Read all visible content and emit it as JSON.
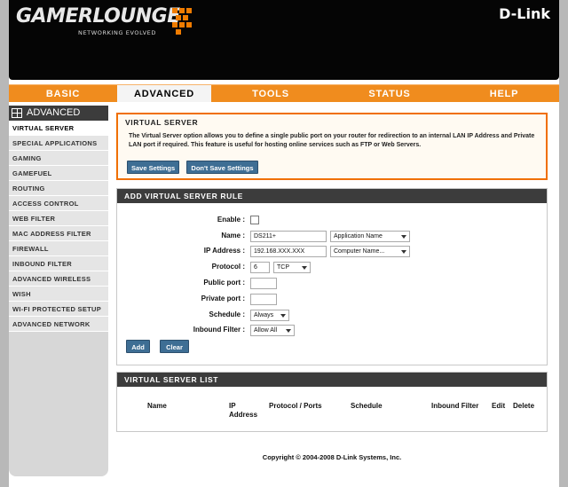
{
  "header": {
    "brand": "GAMERLOUNGE",
    "tagline": "NETWORKING EVOLVED",
    "vendor": "D-Link"
  },
  "topnav": [
    {
      "label": "BASIC",
      "active": false
    },
    {
      "label": "ADVANCED",
      "active": true
    },
    {
      "label": "TOOLS",
      "active": false
    },
    {
      "label": "STATUS",
      "active": false
    },
    {
      "label": "HELP",
      "active": false
    }
  ],
  "sidebar": {
    "title": "ADVANCED",
    "items": [
      {
        "label": "VIRTUAL SERVER",
        "active": true
      },
      {
        "label": "SPECIAL APPLICATIONS"
      },
      {
        "label": "GAMING"
      },
      {
        "label": "GAMEFUEL"
      },
      {
        "label": "ROUTING"
      },
      {
        "label": "ACCESS CONTROL"
      },
      {
        "label": "WEB FILTER"
      },
      {
        "label": "MAC ADDRESS FILTER"
      },
      {
        "label": "FIREWALL"
      },
      {
        "label": "INBOUND FILTER"
      },
      {
        "label": "ADVANCED WIRELESS"
      },
      {
        "label": "WISH"
      },
      {
        "label": "WI-FI PROTECTED SETUP"
      },
      {
        "label": "ADVANCED NETWORK"
      }
    ]
  },
  "virtual_server": {
    "title": "VIRTUAL SERVER",
    "description": "The Virtual Server option allows you to define a single public port on your router for redirection to an internal LAN IP Address and Private LAN port if required. This feature is useful for hosting online services such as FTP or Web Servers.",
    "save_label": "Save Settings",
    "dont_save_label": "Don't Save Settings"
  },
  "rule": {
    "title": "ADD VIRTUAL SERVER RULE",
    "enable_label": "Enable :",
    "name_label": "Name :",
    "name_value": "DS211+",
    "name_select": "Application Name",
    "ip_label": "IP Address :",
    "ip_value": "192.168.XXX.XXX",
    "ip_select": "Computer Name...",
    "protocol_label": "Protocol :",
    "protocol_value": "6",
    "protocol_select": "TCP",
    "public_port_label": "Public port :",
    "public_port_value": "",
    "private_port_label": "Private port :",
    "private_port_value": "",
    "schedule_label": "Schedule :",
    "schedule_select": "Always",
    "inbound_label": "Inbound Filter :",
    "inbound_select": "Allow All",
    "add_label": "Add",
    "clear_label": "Clear"
  },
  "list": {
    "title": "VIRTUAL SERVER LIST",
    "columns": {
      "name": "Name",
      "ip_line1": "IP",
      "ip_line2": "Address",
      "protocol": "Protocol / Ports",
      "schedule": "Schedule",
      "inbound": "Inbound Filter",
      "edit": "Edit",
      "delete": "Delete"
    }
  },
  "footer": {
    "copyright": "Copyright © 2004-2008 D-Link Systems, Inc."
  },
  "colors": {
    "accent": "#f08c1e",
    "button": "#3e6e94",
    "panel_header": "#3c3c3c"
  }
}
